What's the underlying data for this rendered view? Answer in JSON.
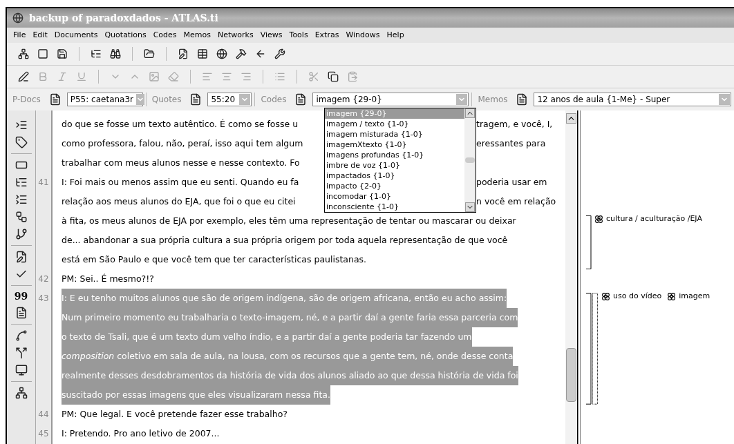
{
  "window": {
    "title": "backup of paradoxdados - ATLAS.ti"
  },
  "menu": [
    "File",
    "Edit",
    "Documents",
    "Quotations",
    "Codes",
    "Memos",
    "Networks",
    "Views",
    "Tools",
    "Extras",
    "Windows",
    "Help"
  ],
  "navigator": {
    "pdocs": {
      "label": "P-Docs",
      "value": "P55: caetana3r"
    },
    "quotes": {
      "label": "Quotes",
      "value": "55:20"
    },
    "codes": {
      "label": "Codes",
      "value": "imagem {29-0}",
      "items": [
        {
          "label": "imagem {29-0}",
          "selected": true
        },
        {
          "label": "imagem / texto {1-0}",
          "selected": false
        },
        {
          "label": "imagem misturada {1-0}",
          "selected": false
        },
        {
          "label": "imagemXtexto {1-0}",
          "selected": false
        },
        {
          "label": "imagens profundas {1-0}",
          "selected": false
        },
        {
          "label": "imbre de voz {1-0}",
          "selected": false
        },
        {
          "label": "impactados {1-0}",
          "selected": false
        },
        {
          "label": "impacto {2-0}",
          "selected": false
        },
        {
          "label": "incomodar {1-0}",
          "selected": false
        },
        {
          "label": "inconsciente {1-0}",
          "selected": false
        }
      ]
    },
    "memos": {
      "label": "Memos",
      "value": "12 anos de aula {1-Me} - Super"
    }
  },
  "side_toolbar": [
    {
      "kind": "icon"
    },
    {
      "kind": "icon"
    },
    {
      "kind": "separator"
    },
    {
      "kind": "icon"
    },
    {
      "kind": "icon"
    },
    {
      "kind": "icon"
    },
    {
      "kind": "icon"
    },
    {
      "kind": "icon"
    },
    {
      "kind": "separator"
    },
    {
      "kind": "icon"
    },
    {
      "kind": "icon"
    },
    {
      "kind": "separator"
    },
    {
      "kind": "text",
      "label": "99"
    },
    {
      "kind": "icon"
    },
    {
      "kind": "separator"
    },
    {
      "kind": "icon"
    },
    {
      "kind": "icon"
    },
    {
      "kind": "icon"
    },
    {
      "kind": "separator"
    },
    {
      "kind": "icon"
    }
  ],
  "document": {
    "lines": [
      {
        "text": "do que se fosse um texto autêntico. É como se fosse u",
        "after": "tragem, e você, I,",
        "selected": false
      },
      {
        "text": "como professora, falou, não, peraí, isso aqui tem algum",
        "after": "eressantes para",
        "selected": false
      },
      {
        "text": "trabalhar com meus alunos nesse e nesse contexto. Fo",
        "selected": false
      },
      {
        "number": "41",
        "text": "I: Foi mais ou menos assim que eu senti. Quando eu fa",
        "after": "poderia usar em",
        "selected": false
      },
      {
        "text": "relação aos meus alunos do EJA, que foi o que eu citei",
        "after": "n você em relação",
        "selected": false
      },
      {
        "text": "à fita, os meus alunos de EJA por exemplo, eles têm uma representação de tentar ou mascarar ou deixar",
        "selected": false
      },
      {
        "text": "de... abandonar a sua própria cultura  a sua própria origem por toda aquela representação de que você",
        "selected": false
      },
      {
        "text": "está em São Paulo e que você tem que ter características paulistanas.",
        "selected": false
      },
      {
        "number": "42",
        "text": "PM: Sei.. É mesmo?!?",
        "selected": false
      },
      {
        "number": "43",
        "text": "I: E eu tenho muitos alunos que são de origem indígena, são de origem africana, então eu acho assim:",
        "selected": true
      },
      {
        "text": "Num primeiro momento eu trabalharia o texto-imagem, né, e a partir daí a gente faria essa parceria com",
        "selected": true
      },
      {
        "text": "o texto de Tsali, que é um texto dum velho índio, e a partir daí a gente poderia tar fazendo um",
        "selected": true
      },
      {
        "text": "*composition* coletivo em sala de aula, na lousa, com os recursos que a gente tem, né, onde desse conta",
        "selected": true
      },
      {
        "text": "realmente desses desdobramentos da história de vida dos alunos aliado ao que dessa história de vida foi",
        "selected": true
      },
      {
        "text": "suscitado por essas imagens que eles visualizaram nessa fita.",
        "selected": true
      },
      {
        "number": "44",
        "text": "PM: Que legal. E você pretende fazer esse trabalho?",
        "selected": false
      },
      {
        "number": "45",
        "text": "I: Pretendo. Pro ano letivo de 2007...",
        "selected": false
      }
    ]
  },
  "margin": [
    {
      "codes": [
        "cultura / aculturação /EJA"
      ],
      "nested": false
    },
    {
      "codes": [
        "uso do vídeo",
        "imagem"
      ],
      "nested": true
    }
  ]
}
